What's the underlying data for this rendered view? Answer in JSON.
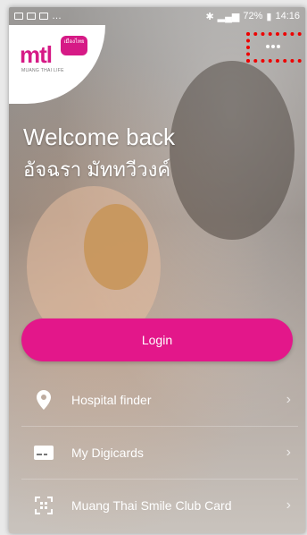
{
  "status": {
    "battery": "72%",
    "time": "14:16"
  },
  "logo": {
    "name": "mtl",
    "badge": "เมืองไทย",
    "subtitle": "MUANG THAI LIFE"
  },
  "header": {
    "more_icon": "more-icon"
  },
  "greeting": {
    "title": "Welcome back",
    "name": "อัจฉรา มัททวีวงค์"
  },
  "login": {
    "label": "Login"
  },
  "menu": {
    "items": [
      {
        "label": "Hospital finder",
        "icon": "location-pin-icon"
      },
      {
        "label": "My Digicards",
        "icon": "card-icon"
      },
      {
        "label": "Muang Thai Smile Club Card",
        "icon": "qr-scan-icon"
      }
    ]
  },
  "colors": {
    "brand": "#e3178a",
    "highlight": "#e00000"
  }
}
